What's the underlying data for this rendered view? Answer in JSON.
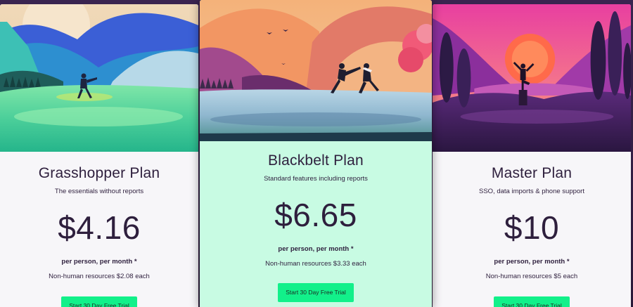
{
  "plans": [
    {
      "name": "Grasshopper Plan",
      "subtitle": "The essentials without reports",
      "price": "$4.16",
      "per": "per person, per month *",
      "extra": "Non-human resources $2.08 each",
      "cta": "Start 30 Day Free Trial",
      "art_icon": "karate-kick-illustration"
    },
    {
      "name": "Blackbelt Plan",
      "subtitle": "Standard features including reports",
      "price": "$6.65",
      "per": "per person, per month *",
      "extra": "Non-human resources $3.33 each",
      "cta": "Start 30 Day Free Trial",
      "art_icon": "sparring-illustration"
    },
    {
      "name": "Master Plan",
      "subtitle": "SSO, data imports & phone support",
      "price": "$10",
      "per": "per person, per month *",
      "extra": "Non-human resources $5 each",
      "cta": "Start 30 Day Free Trial",
      "art_icon": "crane-stance-illustration"
    }
  ],
  "colors": {
    "accent": "#12f08a",
    "featured_bg": "#c8fbe3",
    "card_bg": "#f7f6f9",
    "text": "#2e1f3d"
  }
}
